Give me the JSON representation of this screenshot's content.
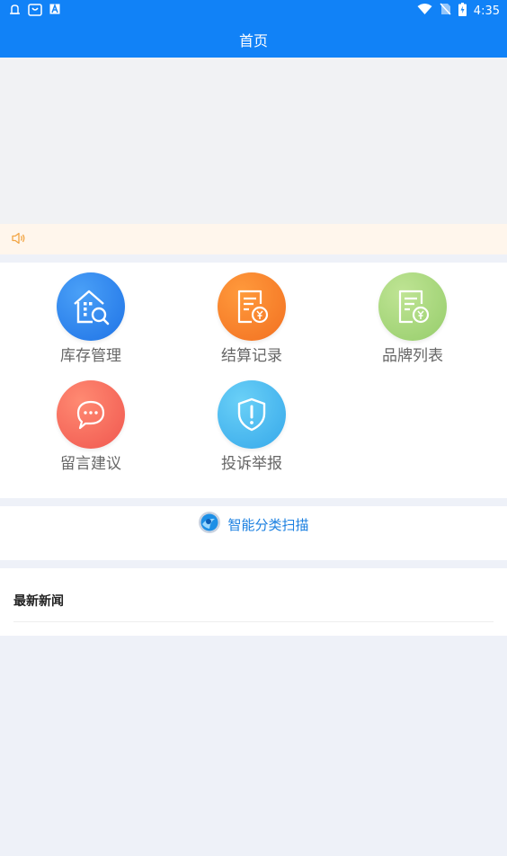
{
  "status_bar": {
    "time": "4:35",
    "left_icons": [
      "notification-icon",
      "shopping-bag-icon",
      "a-box-icon"
    ],
    "right_icons": [
      "wifi-icon",
      "no-sim-icon",
      "battery-charging-icon"
    ]
  },
  "header": {
    "title": "首页"
  },
  "grid": {
    "items": [
      {
        "label": "库存管理",
        "icon": "warehouse-search-icon",
        "color": "#2b86f2"
      },
      {
        "label": "结算记录",
        "icon": "receipt-yen-icon",
        "color": "#f47e24"
      },
      {
        "label": "品牌列表",
        "icon": "list-yen-icon",
        "color": "#a7d57f"
      },
      {
        "label": "留言建议",
        "icon": "chat-bubble-icon",
        "color": "#f2645a"
      },
      {
        "label": "投诉举报",
        "icon": "shield-alert-icon",
        "color": "#45b4ee"
      }
    ]
  },
  "scan": {
    "label": "智能分类扫描",
    "icon": "scan-logo-icon",
    "color": "#1a7fe0"
  },
  "news": {
    "title": "最新新闻"
  },
  "colors": {
    "primary": "#1182f7",
    "notice_bg": "#fff6ec",
    "notice_icon": "#f2a544",
    "page_bg": "#eef1f8"
  }
}
